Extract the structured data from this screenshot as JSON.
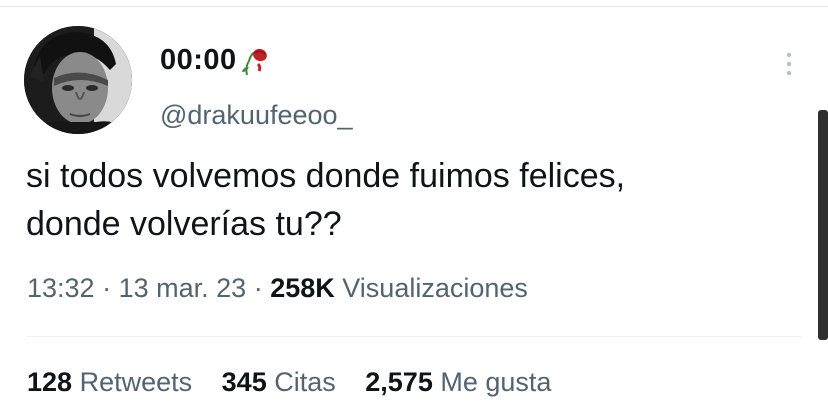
{
  "author": {
    "display_name": "00:00",
    "handle": "@drakuufeeoo_",
    "name_emoji_icon": "wilted-rose-icon"
  },
  "tweet": {
    "line1": "si todos volvemos donde fuimos felices,",
    "line2": "donde volverías tu??"
  },
  "meta": {
    "time": "13:32",
    "sep1": "·",
    "date": "13 mar. 23",
    "sep2": "·",
    "views_count": "258K",
    "views_label": "Visualizaciones"
  },
  "stats": {
    "retweets_count": "128",
    "retweets_label": "Retweets",
    "quotes_count": "345",
    "quotes_label": "Citas",
    "likes_count": "2,575",
    "likes_label": "Me gusta"
  },
  "colors": {
    "text_primary": "#0f1419",
    "text_secondary": "#536471",
    "divider": "#eff3f4"
  }
}
